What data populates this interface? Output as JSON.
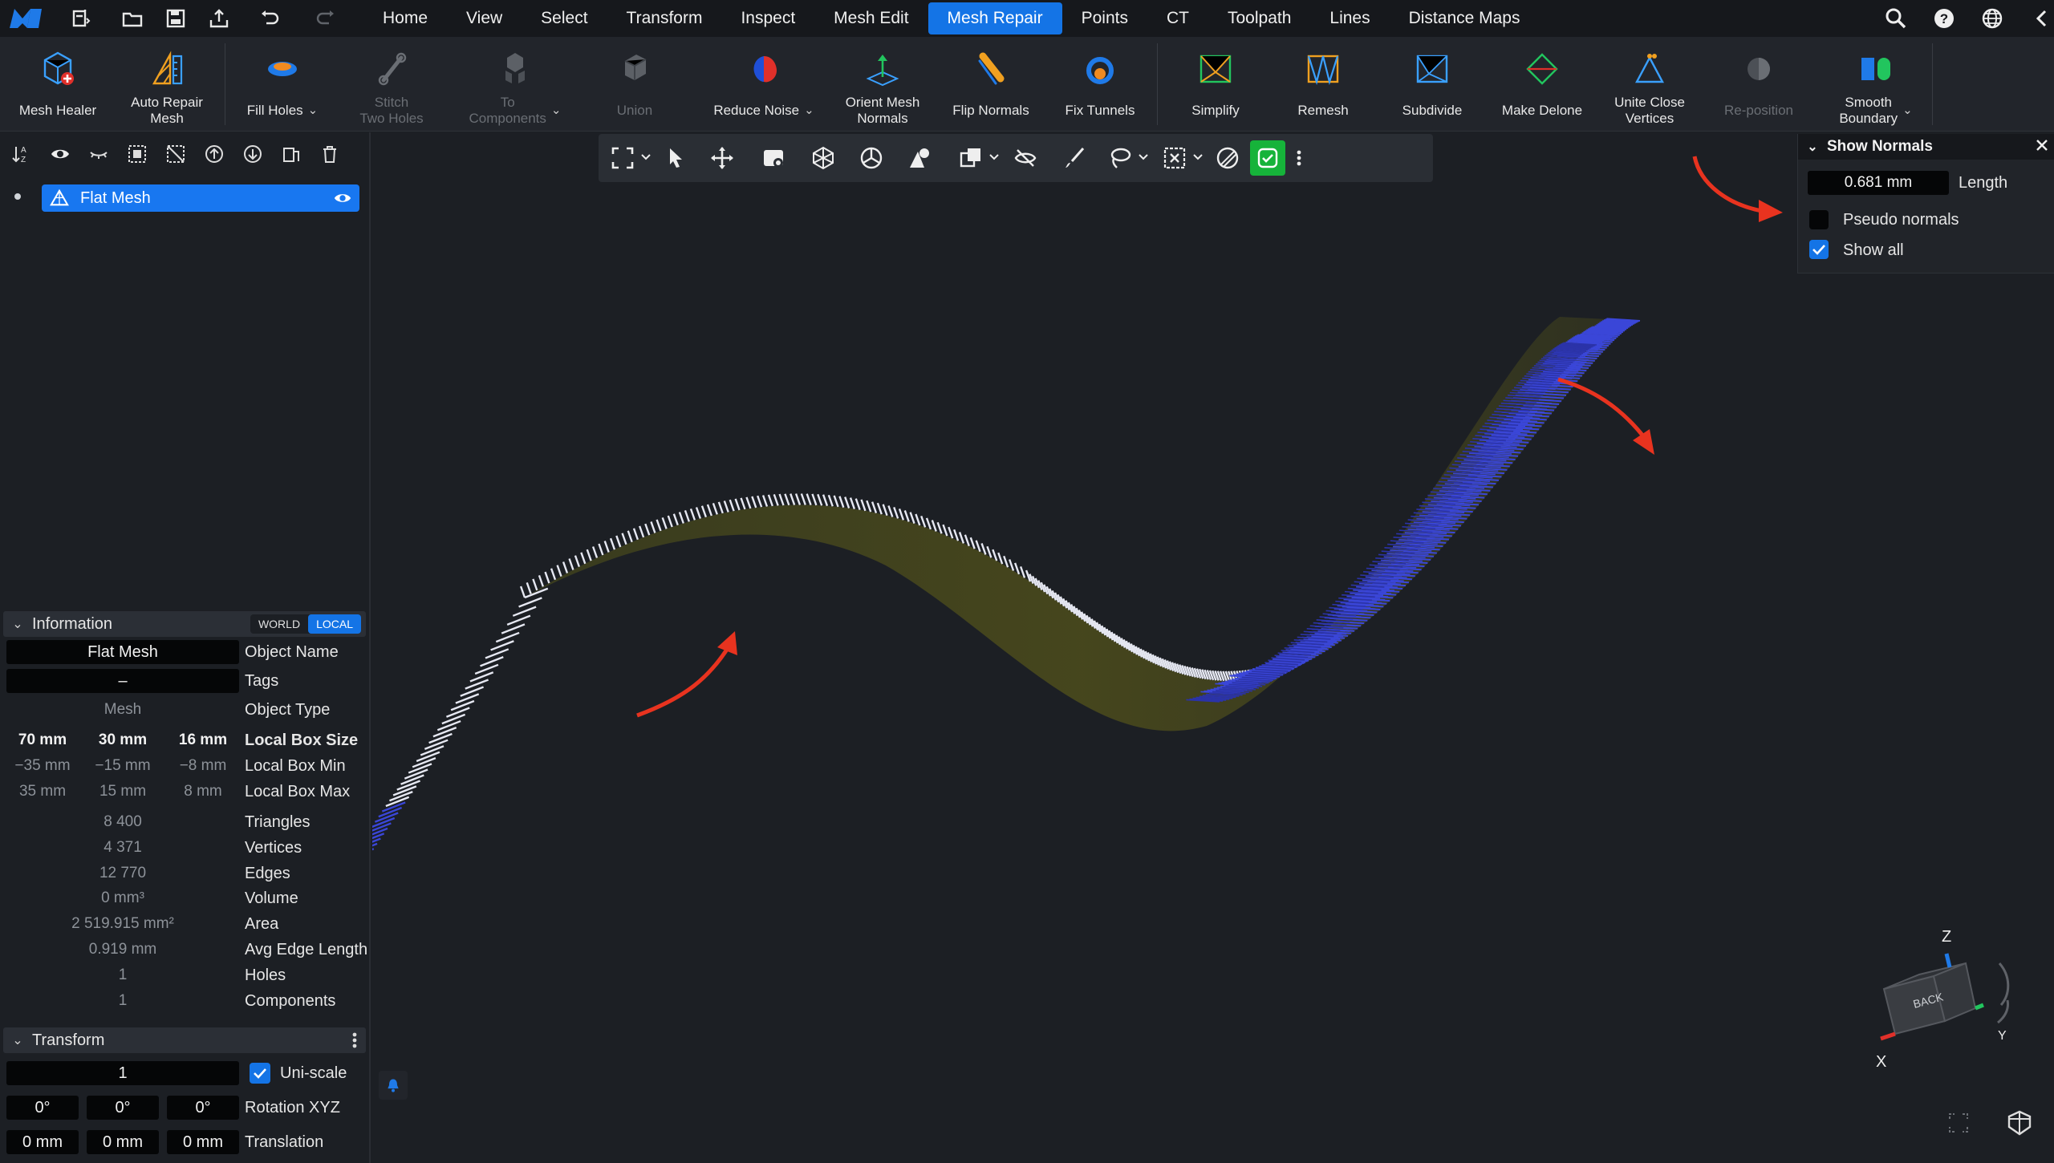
{
  "menu": {
    "items": [
      "Home",
      "View",
      "Select",
      "Transform",
      "Inspect",
      "Mesh Edit",
      "Mesh Repair",
      "Points",
      "CT",
      "Toolpath",
      "Lines",
      "Distance Maps"
    ],
    "active_index": 6
  },
  "ribbon": {
    "tools": [
      {
        "label": "Mesh Healer",
        "icon": "mesh-healer-icon",
        "enabled": true
      },
      {
        "label": "Auto Repair\nMesh",
        "icon": "auto-repair-icon",
        "enabled": true
      },
      {
        "label": "Fill Holes",
        "icon": "fill-holes-icon",
        "enabled": true,
        "dropdown": true
      },
      {
        "label": "Stitch\nTwo Holes",
        "icon": "stitch-icon",
        "enabled": false
      },
      {
        "label": "To\nComponents",
        "icon": "components-icon",
        "enabled": false,
        "dropdown": true
      },
      {
        "label": "Union",
        "icon": "union-icon",
        "enabled": false
      },
      {
        "label": "Reduce Noise",
        "icon": "reduce-noise-icon",
        "enabled": true,
        "dropdown": true
      },
      {
        "label": "Orient Mesh\nNormals",
        "icon": "orient-normals-icon",
        "enabled": true
      },
      {
        "label": "Flip Normals",
        "icon": "flip-normals-icon",
        "enabled": true
      },
      {
        "label": "Fix Tunnels",
        "icon": "fix-tunnels-icon",
        "enabled": true
      },
      {
        "label": "Simplify",
        "icon": "simplify-icon",
        "enabled": true
      },
      {
        "label": "Remesh",
        "icon": "remesh-icon",
        "enabled": true
      },
      {
        "label": "Subdivide",
        "icon": "subdivide-icon",
        "enabled": true
      },
      {
        "label": "Make Delone",
        "icon": "make-delone-icon",
        "enabled": true
      },
      {
        "label": "Unite Close\nVertices",
        "icon": "unite-vertices-icon",
        "enabled": true
      },
      {
        "label": "Re-position",
        "icon": "reposition-icon",
        "enabled": false
      },
      {
        "label": "Smooth\nBoundary",
        "icon": "smooth-boundary-icon",
        "enabled": true,
        "dropdown": true
      }
    ]
  },
  "scene": {
    "object_name": "Flat Mesh"
  },
  "information": {
    "title": "Information",
    "world_label": "WORLD",
    "local_label": "LOCAL",
    "active_space": "LOCAL",
    "object_name": "Flat Mesh",
    "object_name_label": "Object Name",
    "tags": "–",
    "tags_label": "Tags",
    "object_type": "Mesh",
    "object_type_label": "Object Type",
    "box_size": [
      "70 mm",
      "30 mm",
      "16 mm"
    ],
    "box_size_label": "Local Box Size",
    "box_min": [
      "−35 mm",
      "−15 mm",
      "−8 mm"
    ],
    "box_min_label": "Local Box Min",
    "box_max": [
      "35 mm",
      "15 mm",
      "8 mm"
    ],
    "box_max_label": "Local Box Max",
    "stats": [
      {
        "value": "8 400",
        "label": "Triangles"
      },
      {
        "value": "4 371",
        "label": "Vertices"
      },
      {
        "value": "12 770",
        "label": "Edges"
      },
      {
        "value": "0 mm³",
        "label": "Volume"
      },
      {
        "value": "2 519.915 mm²",
        "label": "Area"
      },
      {
        "value": "0.919 mm",
        "label": "Avg Edge Length"
      },
      {
        "value": "1",
        "label": "Holes"
      },
      {
        "value": "1",
        "label": "Components"
      }
    ]
  },
  "transform": {
    "title": "Transform",
    "uni_scale_value": "1",
    "uni_scale_label": "Uni-scale",
    "uni_scale_checked": true,
    "rotation": [
      "0°",
      "0°",
      "0°"
    ],
    "rotation_label": "Rotation XYZ",
    "translation": [
      "0 mm",
      "0 mm",
      "0 mm"
    ],
    "translation_label": "Translation"
  },
  "show_normals": {
    "title": "Show Normals",
    "length_value": "0.681 mm",
    "length_label": "Length",
    "pseudo_normals_label": "Pseudo normals",
    "pseudo_normals_checked": false,
    "show_all_label": "Show all",
    "show_all_checked": true
  },
  "view_cube": {
    "face_label": "BACK",
    "axis_z": "Z",
    "axis_x": "X",
    "axis_y": "Y"
  },
  "colors": {
    "accent": "#1474e6",
    "annotation_arrow": "#e8331f",
    "normals_blue": "#3a46d8",
    "normals_white": "#e6e8f2",
    "surface_olive": "#4a4a1c",
    "confirm_green": "#16b33a"
  }
}
